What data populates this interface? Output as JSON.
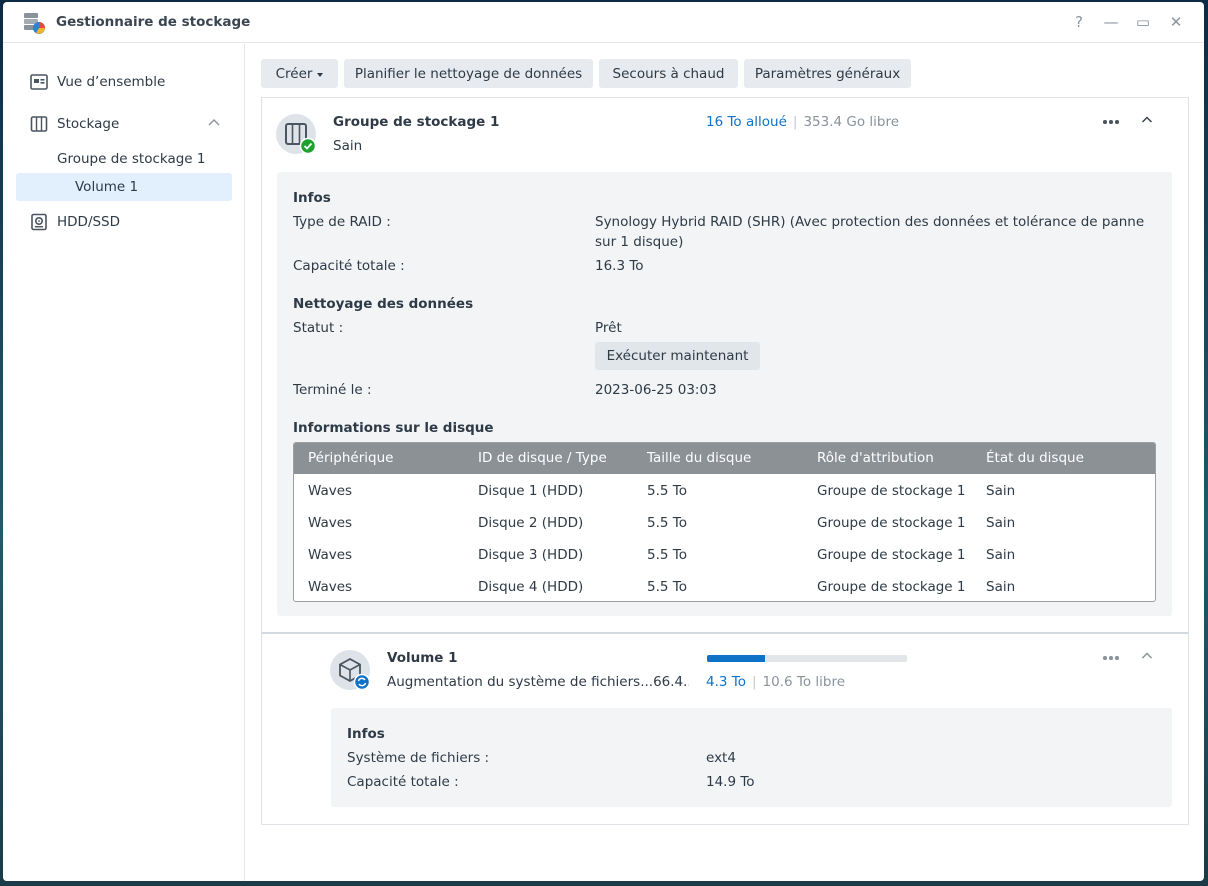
{
  "window": {
    "title": "Gestionnaire de stockage",
    "help_label": "?",
    "minimize_label": "—",
    "maximize_label": "▭",
    "close_label": "✕"
  },
  "sidebar": {
    "items": [
      {
        "label": "Vue d’ensemble",
        "icon": "overview-icon"
      },
      {
        "label": "Stockage",
        "icon": "storage-icon"
      },
      {
        "label": "Groupe de stockage 1"
      },
      {
        "label": "Volume 1",
        "selected": true
      },
      {
        "label": "HDD/SSD",
        "icon": "hdd-icon"
      }
    ]
  },
  "toolbar": {
    "create_label": "Créer",
    "schedule_label": "Planifier le nettoyage de données",
    "hot_spare_label": "Secours à chaud",
    "settings_label": "Paramètres généraux"
  },
  "pool": {
    "title": "Groupe de stockage 1",
    "status": "Sain",
    "allocated": "16 To alloué",
    "separator": "|",
    "free": "353.4 Go libre",
    "info_heading": "Infos",
    "raid_type_label": "Type de RAID :",
    "raid_type_value": "Synology Hybrid RAID (SHR) (Avec protection des données et tolérance de panne sur 1 disque)",
    "total_capacity_label": "Capacité totale :",
    "total_capacity_value": "16.3 To",
    "scrub_heading": "Nettoyage des données",
    "scrub_status_label": "Statut :",
    "scrub_status_value": "Prêt",
    "run_now_label": "Exécuter maintenant",
    "finished_label": "Terminé le :",
    "finished_value": "2023-06-25 03:03",
    "disk_heading": "Informations sur le disque",
    "columns": [
      "Périphérique",
      "ID de disque / Type",
      "Taille du disque",
      "Rôle d'attribution",
      "État du disque"
    ],
    "disks": [
      [
        "Waves",
        "Disque 1 (HDD)",
        "5.5 To",
        "Groupe de stockage 1",
        "Sain"
      ],
      [
        "Waves",
        "Disque 2 (HDD)",
        "5.5 To",
        "Groupe de stockage 1",
        "Sain"
      ],
      [
        "Waves",
        "Disque 3 (HDD)",
        "5.5 To",
        "Groupe de stockage 1",
        "Sain"
      ],
      [
        "Waves",
        "Disque 4 (HDD)",
        "5.5 To",
        "Groupe de stockage 1",
        "Sain"
      ]
    ]
  },
  "volume": {
    "title": "Volume 1",
    "status": "Augmentation du système de fichiers...66.4...",
    "used": "4.3 To",
    "separator": "|",
    "free": "10.6 To libre",
    "usage_fraction": 0.29,
    "info_heading": "Infos",
    "fs_label": "Système de fichiers :",
    "fs_value": "ext4",
    "total_capacity_label": "Capacité totale :",
    "total_capacity_value": "14.9 To"
  },
  "colors": {
    "accent": "#0f72c9",
    "healthy": "#1ea12f",
    "selected_bg": "#e2f0fd"
  }
}
